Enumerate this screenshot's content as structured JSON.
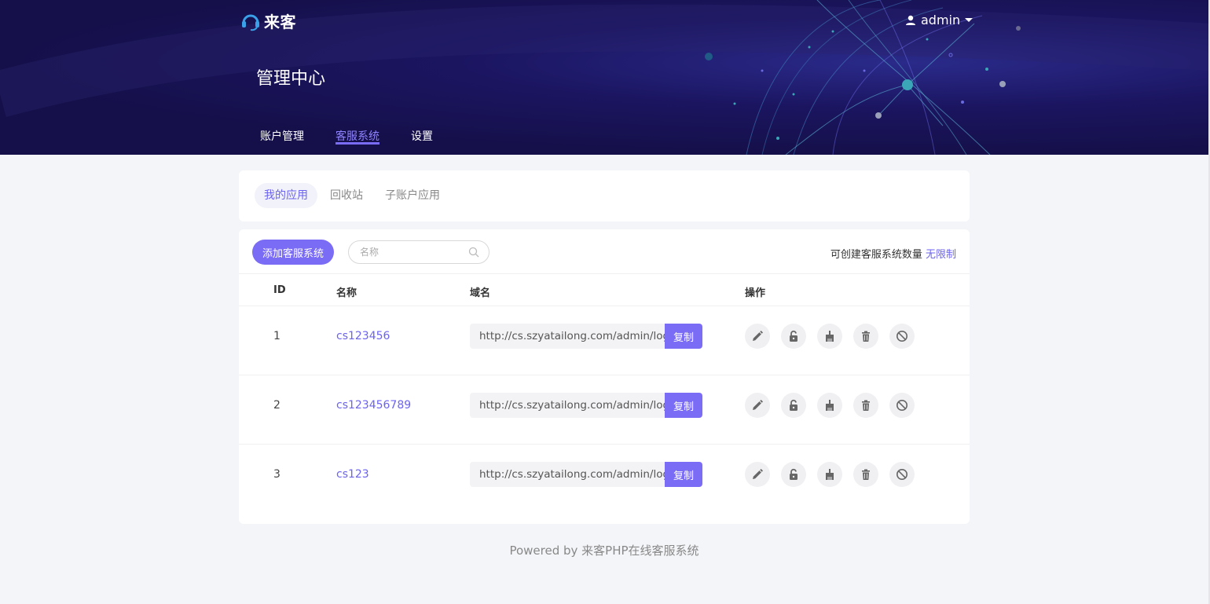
{
  "app": {
    "logo_text": "来客"
  },
  "user": {
    "name": "admin"
  },
  "page": {
    "title": "管理中心"
  },
  "main_nav": {
    "items": [
      {
        "label": "账户管理",
        "active": false
      },
      {
        "label": "客服系统",
        "active": true
      },
      {
        "label": "设置",
        "active": false
      }
    ]
  },
  "subtabs": {
    "items": [
      {
        "label": "我的应用",
        "active": true
      },
      {
        "label": "回收站",
        "active": false
      },
      {
        "label": "子账户应用",
        "active": false
      }
    ]
  },
  "toolbar": {
    "add_label": "添加客服系统",
    "search_placeholder": "名称",
    "quota_label": "可创建客服系统数量",
    "quota_value": "无限制"
  },
  "table": {
    "columns": [
      "ID",
      "名称",
      "域名",
      "操作"
    ],
    "copy_label": "复制",
    "rows": [
      {
        "id": "1",
        "name": "cs123456",
        "domain": "http://cs.szyatailong.com/admin/login/"
      },
      {
        "id": "2",
        "name": "cs123456789",
        "domain": "http://cs.szyatailong.com/admin/login/"
      },
      {
        "id": "3",
        "name": "cs123",
        "domain": "http://cs.szyatailong.com/admin/login/"
      }
    ],
    "action_icons": [
      "edit-icon",
      "unlock-icon",
      "clean-icon",
      "delete-icon",
      "disable-icon"
    ]
  },
  "footer": {
    "text": "Powered by 来客PHP在线客服系统"
  },
  "colors": {
    "accent": "#7b6cf6",
    "hero_bg": "#15104a"
  }
}
